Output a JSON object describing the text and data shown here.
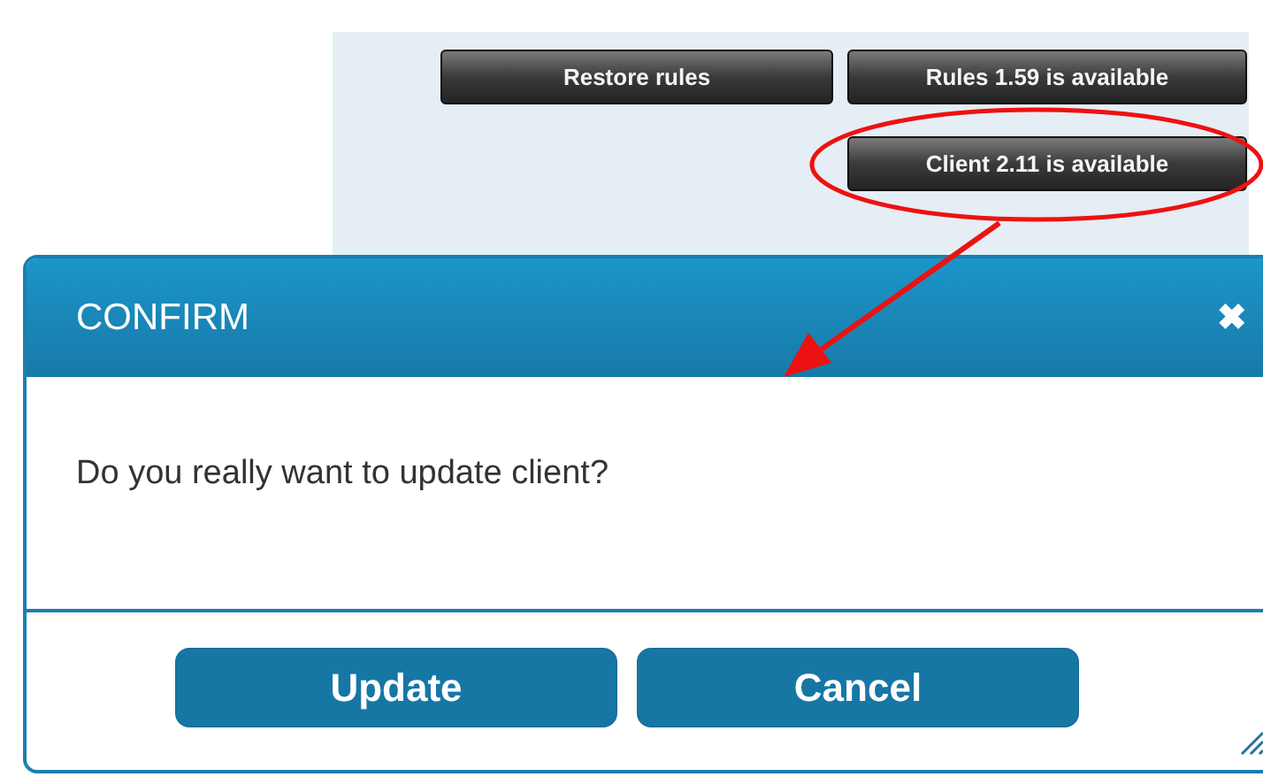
{
  "toolbar": {
    "buttons": [
      {
        "label": "Restore rules"
      },
      {
        "label": "Rules 1.59 is available"
      },
      {
        "label": "Client 2.11 is available",
        "highlighted": true
      }
    ]
  },
  "dialog": {
    "title": "CONFIRM",
    "close": "✖",
    "message": "Do you really want to update client?",
    "buttons": [
      {
        "label": "Update"
      },
      {
        "label": "Cancel"
      }
    ]
  }
}
